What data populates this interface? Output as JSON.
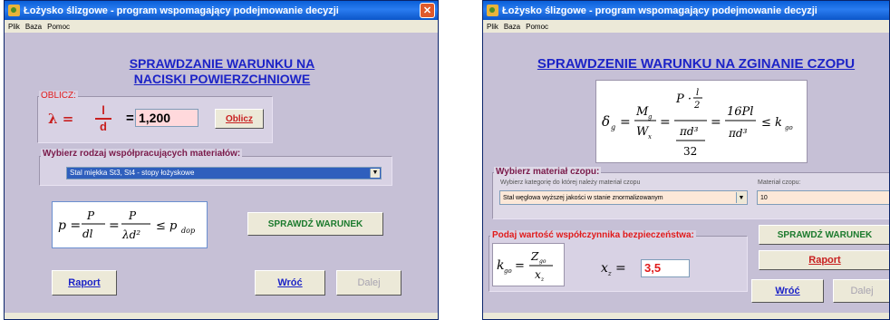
{
  "left": {
    "title": "Łożysko ślizgowe - program wspomagający podejmowanie decyzji",
    "close_glyph": "✕",
    "menu": [
      "Plik",
      "Baza",
      "Pomoc"
    ],
    "heading_line1": "SPRAWDZANIE WARUNKU NA",
    "heading_line2": "NACISKI POWIERZCHNIOWE",
    "oblicz_group": "OBLICZ:",
    "lambda_symbol": "λ =",
    "lambda_num": "l",
    "lambda_den": "d",
    "equals": "=",
    "lambda_value": "1,200",
    "oblicz_button": "Oblicz",
    "materials_group": "Wybierz rodzaj współpracujących materiałów:",
    "materials_selected": "Stal miękka St3, St4 - stopy łożyskowe",
    "check_button": "SPRAWDŹ WARUNEK",
    "report_button": "Raport",
    "back_button": "Wróć",
    "next_button": "Dalej"
  },
  "right": {
    "title": "Łożysko ślizgowe - program wspomagający podejmowanie decyzji",
    "menu": [
      "Plik",
      "Baza",
      "Pomoc"
    ],
    "heading": "SPRAWDZENIE WARUNKU NA ZGINANIE CZOPU",
    "material_group": "Wybierz materiał czopu:",
    "category_label": "Wybierz kategorię do której należy materiał czopu",
    "category_selected": "Stal węglowa wyższej jakości w stanie znormalizowanym",
    "material_label": "Materiał czopu:",
    "material_selected": "10",
    "safety_group": "Podaj wartość współczynnika bezpieczeństwa:",
    "xz_value": "3,5",
    "check_button": "SPRAWDŹ WARUNEK",
    "report_button": "Raport",
    "back_button": "Wróć",
    "next_button": "Dalej"
  },
  "colors": {
    "heading": "#1c23c7",
    "green": "#1b7a2d",
    "red": "#e11b1b",
    "group_label": "#7a1a4a",
    "pink_field": "#ffd9dc"
  },
  "icons": [
    "app-icon",
    "close-icon",
    "dropdown-arrow-icon"
  ]
}
